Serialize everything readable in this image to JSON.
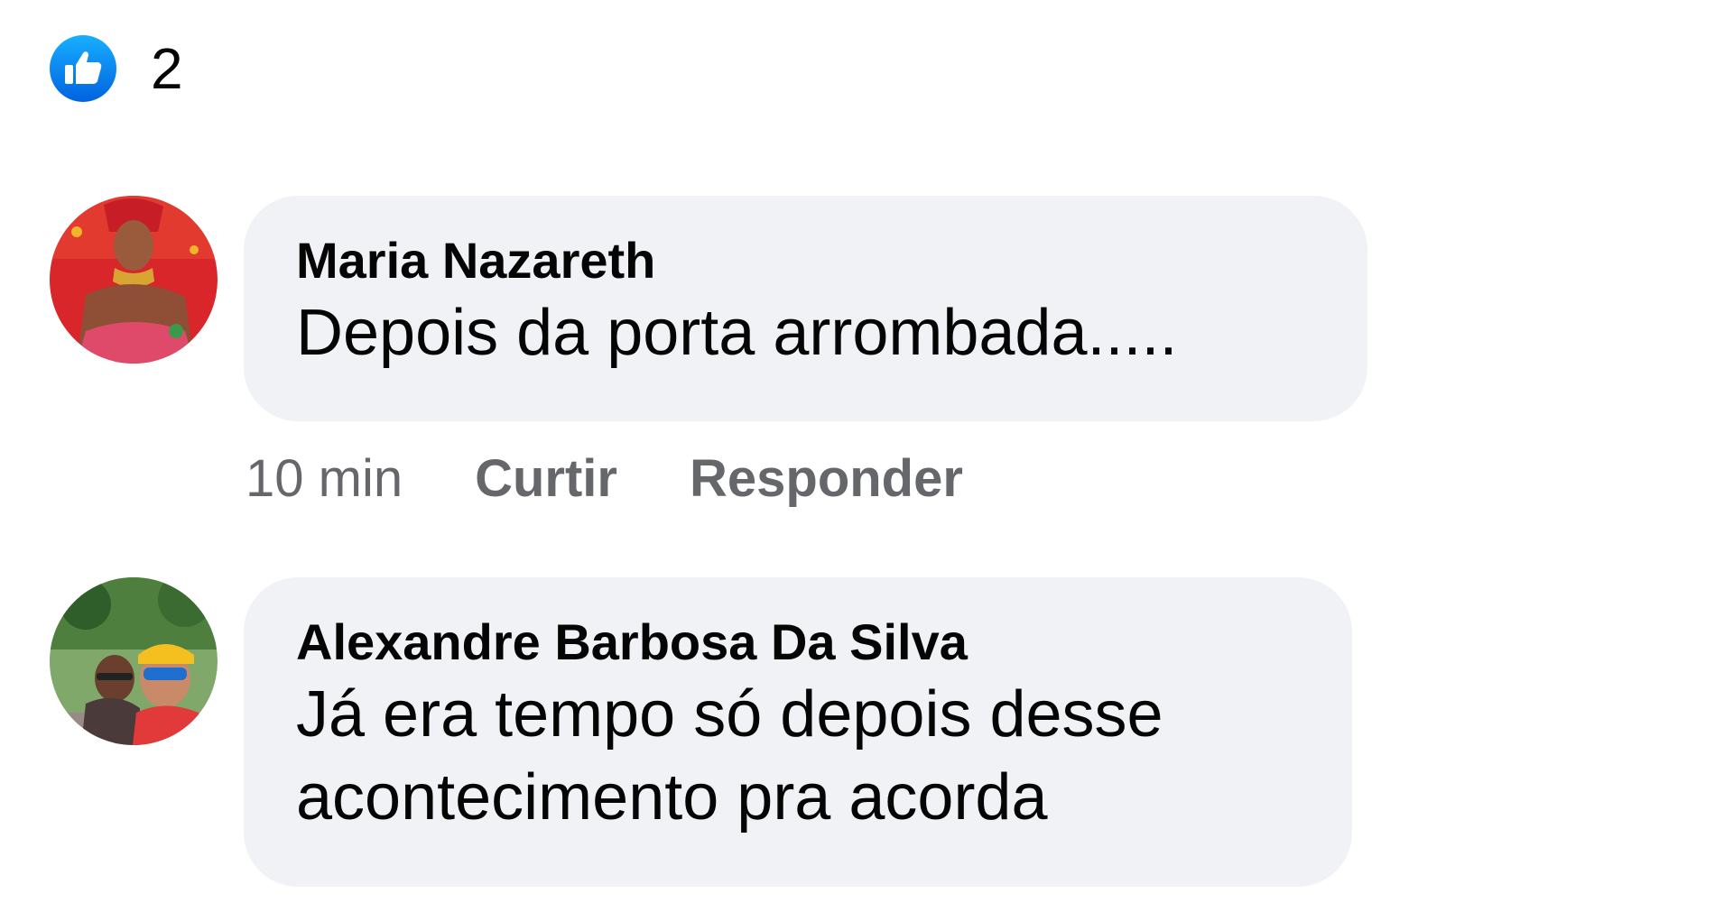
{
  "reactions": {
    "icon": "like-icon",
    "count": "2",
    "color": "#1877f2"
  },
  "comments": [
    {
      "author": "Maria Nazareth",
      "text": "Depois da porta arrombada.....",
      "time": "10 min",
      "like_label": "Curtir",
      "reply_label": "Responder"
    },
    {
      "author": "Alexandre Barbosa Da Silva",
      "text_lines": [
        "Já era tempo só depois desse",
        "acontecimento pra acorda"
      ]
    }
  ]
}
